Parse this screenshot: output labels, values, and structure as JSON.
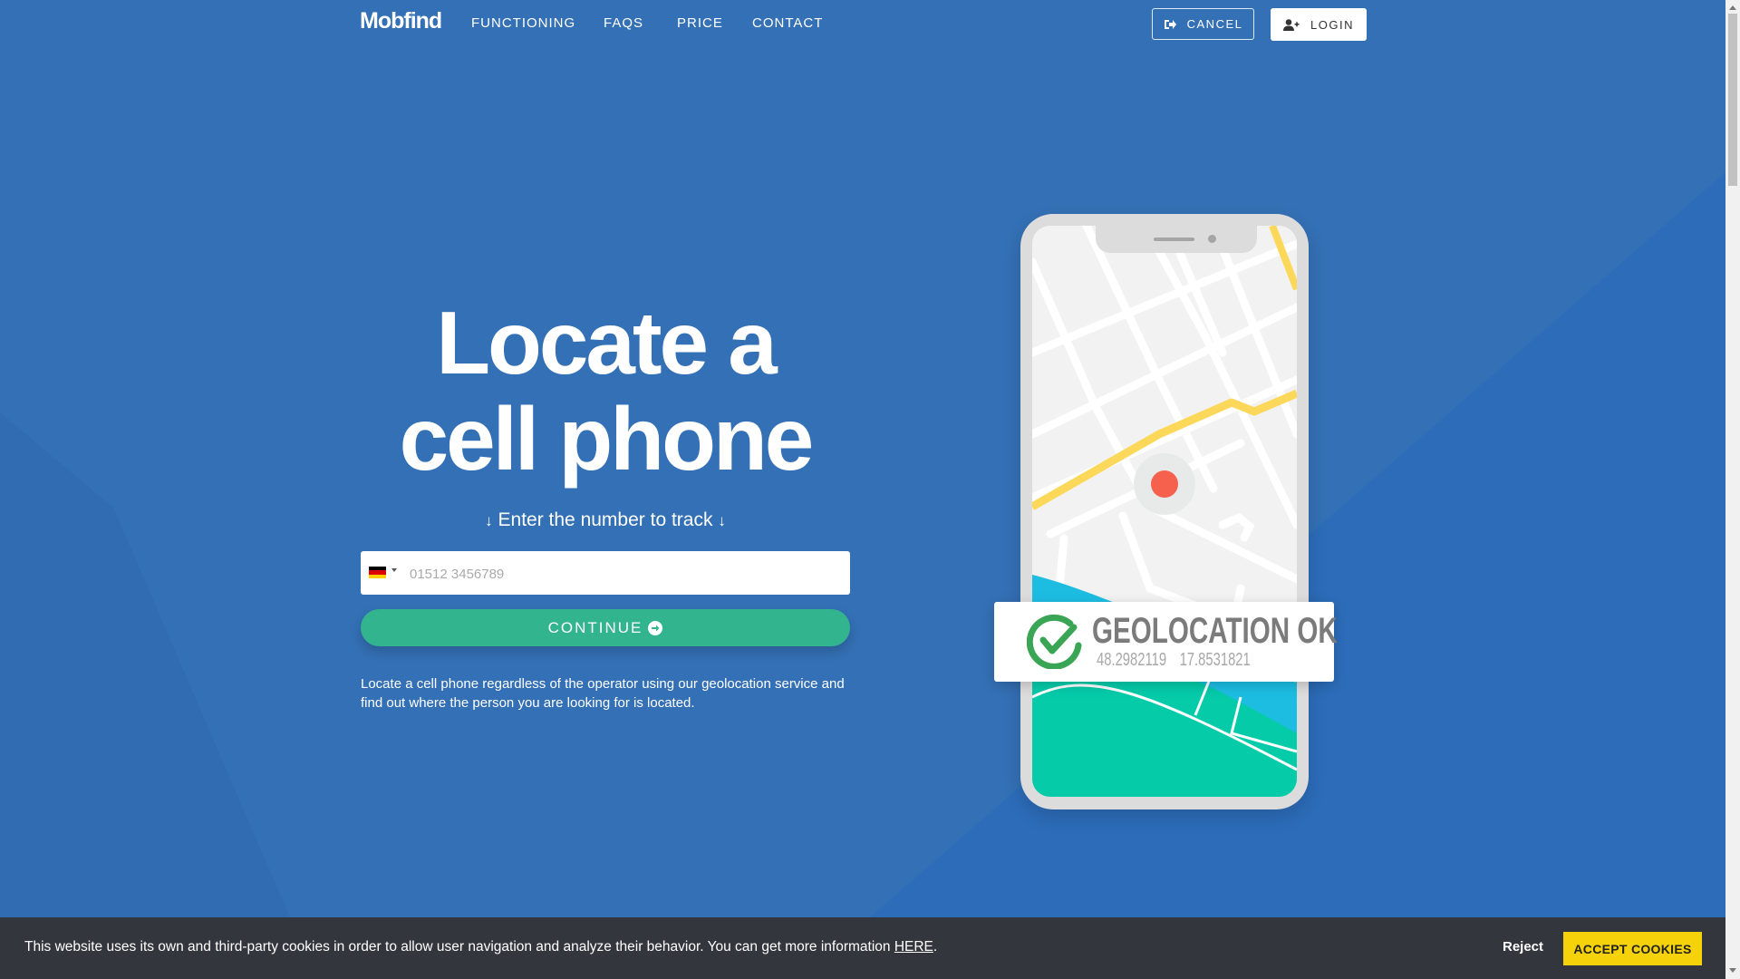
{
  "header": {
    "logo": "Mobfind",
    "nav": [
      {
        "label": "FUNCTIONING"
      },
      {
        "label": "FAQS"
      },
      {
        "label": "PRICE"
      },
      {
        "label": "CONTACT"
      }
    ],
    "cancel_label": "CANCEL",
    "login_label": "LOGIN"
  },
  "hero": {
    "title_line1": "Locate a",
    "title_line2": "cell phone",
    "subtitle": "Enter the number to track",
    "phone_input": {
      "country": "DE",
      "value": "",
      "placeholder": "01512 3456789"
    },
    "continue_label": "CONTINUE",
    "description": "Locate a cell phone regardless of the operator using our geolocation service and find out where the person you are looking for is located."
  },
  "illustration": {
    "badge_title": "GEOLOCATION OK",
    "latitude": "48.2982119",
    "longitude": "17.8531821"
  },
  "cookie_bar": {
    "text": "This website uses its own and third-party cookies in order to allow user navigation and analyze their behavior. You can get more information ",
    "link_label": "HERE",
    "after_link": ".",
    "reject_label": "Reject",
    "accept_label": "ACCEPT COOKIES"
  },
  "colors": {
    "background": "#3470b5",
    "continue_button": "#32b48e",
    "accept_button": "#f5d20a",
    "cookie_bar": "#34363d",
    "check_green": "#3aa655",
    "map_pin": "#f5614d"
  }
}
